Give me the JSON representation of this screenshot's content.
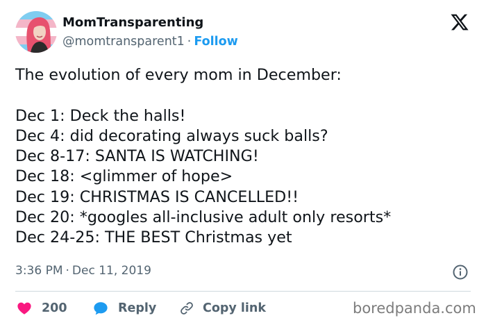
{
  "author": {
    "display_name": "MomTransparenting",
    "handle": "@momtransparent1",
    "separator": "·",
    "follow_label": "Follow"
  },
  "tweet": {
    "lines": [
      "The evolution of every mom in December:",
      "",
      "Dec 1: Deck the halls!",
      "Dec 4: did decorating always suck balls?",
      "Dec 8-17: SANTA IS WATCHING!",
      "Dec 18: <glimmer of hope>",
      "Dec 19: CHRISTMAS IS CANCELLED!!",
      "Dec 20: *googles all-inclusive adult only resorts*",
      "Dec 24-25: THE BEST Christmas yet"
    ],
    "time": "3:36 PM",
    "date": "Dec 11, 2019",
    "meta_separator": "·"
  },
  "actions": {
    "like_count": "200",
    "reply_label": "Reply",
    "copy_label": "Copy link"
  },
  "watermark": "boredpanda.com",
  "icons": {
    "platform": "x-logo-icon",
    "like": "heart-icon",
    "reply": "speech-bubble-icon",
    "copy": "link-icon",
    "info": "info-icon"
  },
  "colors": {
    "follow": "#1d9bf0",
    "heart": "#f91880",
    "reply_bubble": "#1d9bf0",
    "muted": "#536471",
    "text": "#0f1419"
  }
}
